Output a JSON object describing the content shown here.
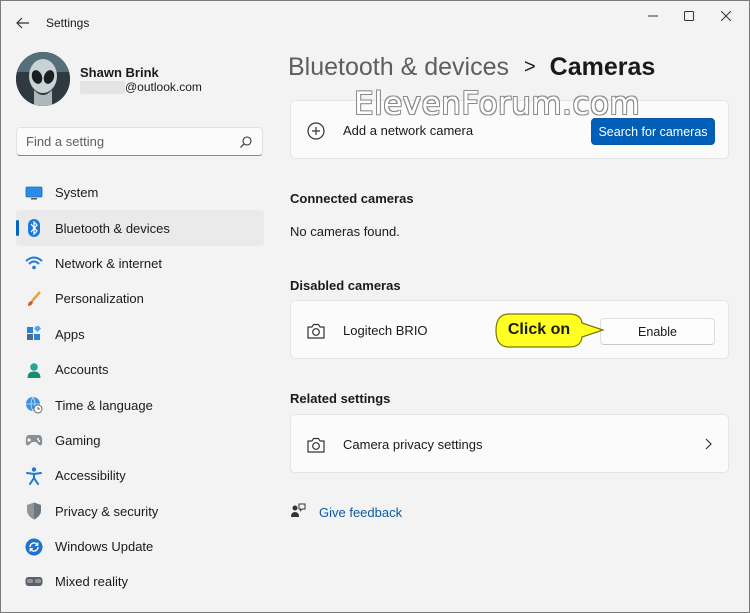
{
  "window": {
    "title": "Settings",
    "controls": {
      "minimize": "minimize-icon",
      "maximize": "maximize-icon",
      "close": "close-icon"
    }
  },
  "profile": {
    "name": "Shawn Brink",
    "email_suffix": "@outlook.com"
  },
  "search": {
    "placeholder": "Find a setting"
  },
  "sidebar": {
    "items": [
      {
        "label": "System",
        "icon": "system-monitor-icon",
        "active": false
      },
      {
        "label": "Bluetooth & devices",
        "icon": "bluetooth-icon",
        "active": true
      },
      {
        "label": "Network & internet",
        "icon": "wifi-icon",
        "active": false
      },
      {
        "label": "Personalization",
        "icon": "brush-icon",
        "active": false
      },
      {
        "label": "Apps",
        "icon": "apps-icon",
        "active": false
      },
      {
        "label": "Accounts",
        "icon": "person-icon",
        "active": false
      },
      {
        "label": "Time & language",
        "icon": "globe-clock-icon",
        "active": false
      },
      {
        "label": "Gaming",
        "icon": "gamepad-icon",
        "active": false
      },
      {
        "label": "Accessibility",
        "icon": "accessibility-icon",
        "active": false
      },
      {
        "label": "Privacy & security",
        "icon": "shield-icon",
        "active": false
      },
      {
        "label": "Windows Update",
        "icon": "update-icon",
        "active": false
      },
      {
        "label": "Mixed reality",
        "icon": "vr-headset-icon",
        "active": false
      }
    ]
  },
  "header": {
    "parent": "Bluetooth & devices",
    "separator": ">",
    "current": "Cameras"
  },
  "add_camera": {
    "label": "Add a network camera",
    "button": "Search for cameras"
  },
  "connected": {
    "title": "Connected cameras",
    "empty_text": "No cameras found."
  },
  "disabled": {
    "title": "Disabled cameras",
    "camera_name": "Logitech BRIO",
    "button": "Enable"
  },
  "related": {
    "title": "Related settings",
    "privacy_label": "Camera privacy settings"
  },
  "feedback": {
    "label": "Give feedback"
  },
  "watermark": {
    "text": "ElevenForum.com"
  },
  "callout": {
    "text": "Click on"
  },
  "colors": {
    "accent": "#005fb8",
    "callout_fill": "#ffff22",
    "background": "#f3f3f3"
  }
}
